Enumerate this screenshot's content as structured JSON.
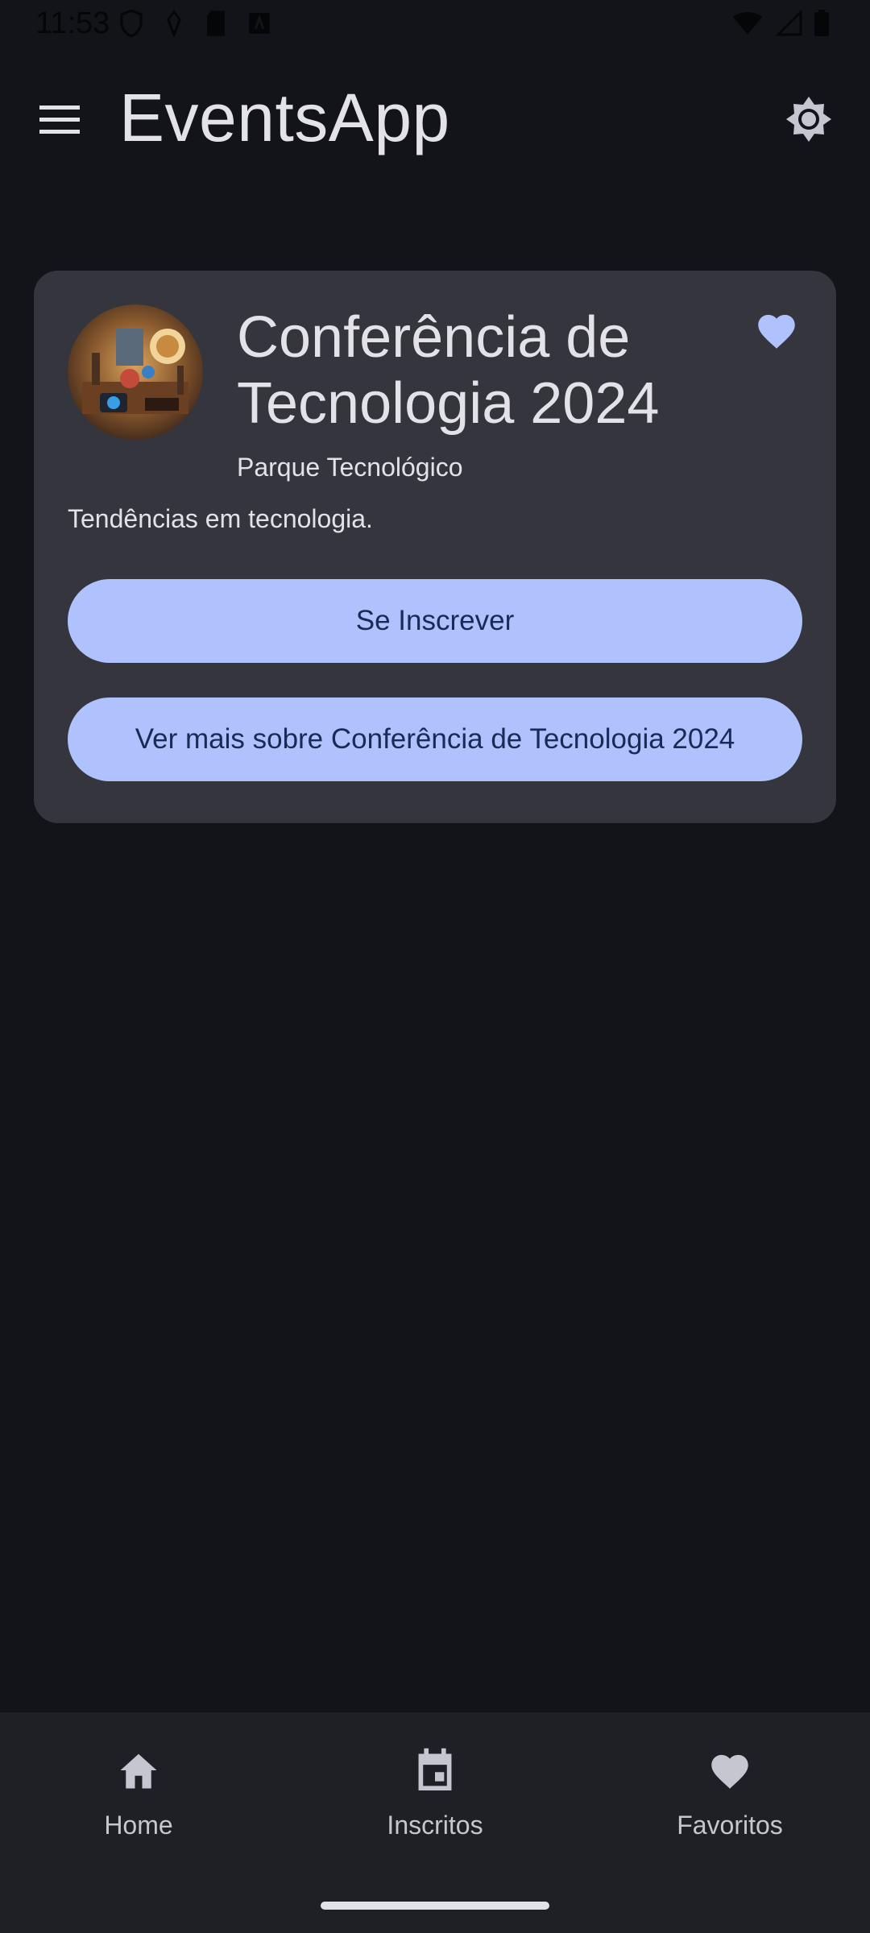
{
  "status_bar": {
    "time": "11:53"
  },
  "app_bar": {
    "title": "EventsApp",
    "menu_icon": "hamburger-menu-icon",
    "theme_icon": "brightness-icon"
  },
  "event_card": {
    "title": "Conferência de Tecnologia 2024",
    "location": "Parque Tecnológico",
    "description": "Tendências em tecnologia.",
    "favorite_icon": "heart-icon",
    "subscribe_label": "Se Inscrever",
    "more_label": "Ver mais sobre Conferência de Tecnologia 2024"
  },
  "bottom_nav": {
    "items": [
      {
        "label": "Home",
        "icon": "home-icon"
      },
      {
        "label": "Inscritos",
        "icon": "calendar-icon"
      },
      {
        "label": "Favoritos",
        "icon": "heart-icon"
      }
    ]
  },
  "colors": {
    "background": "#131419",
    "card": "#34353d",
    "accent": "#b0c2fd",
    "button_text": "#172a58",
    "nav_background": "#1f2026"
  }
}
